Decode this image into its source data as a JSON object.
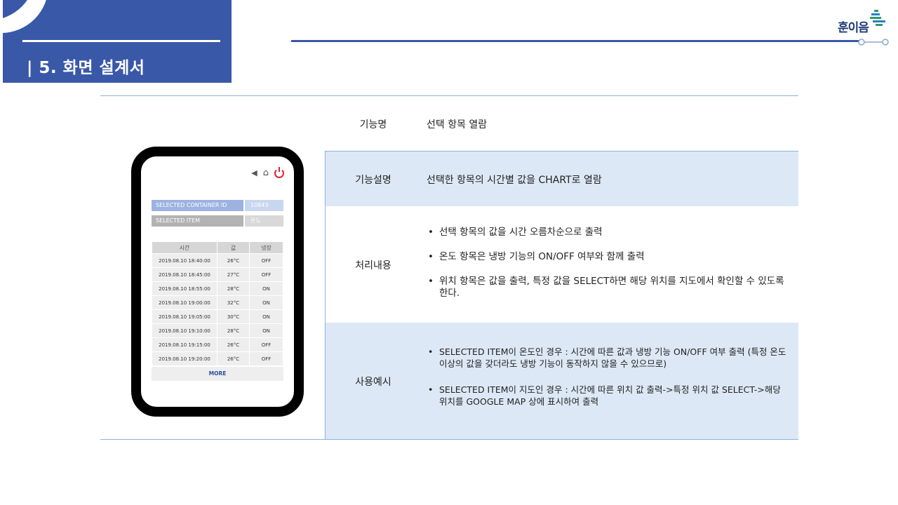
{
  "header": {
    "title": "| 5. 화면 설계서"
  },
  "logo": {
    "text": "훈이음"
  },
  "table": {
    "rows": [
      {
        "label": "기능명",
        "value": "선택 항목 열람"
      },
      {
        "label": "기능설명",
        "value": "선택한 항목의 시간별 값을 CHART로 열람"
      },
      {
        "label": "처리내용",
        "bullets": [
          "선택 항목의 값을 시간 오름차순으로 출력",
          "온도 항목은 냉방 기능의 ON/OFF 여부와 함께 출력",
          "위치 항목은 값을 출력, 특정 값을 SELECT하면 해당 위치를 지도에서 확인할 수 있도록 한다."
        ]
      },
      {
        "label": "사용예시",
        "bullets": [
          "SELECTED ITEM이 온도인 경우 : 시간에 따른 값과 냉방 기능 ON/OFF 여부 출력 (특정 온도 이상의 값을 갖더라도 냉방 기능이 동작하지 않을 수 있으므로)",
          "SELECTED ITEM이 지도인 경우 : 시간에 따른 위치 값 출력->특정 위치 값 SELECT->해당 위치를 GOOGLE MAP 상에 표시하여 출력"
        ]
      }
    ]
  },
  "phone": {
    "icons": [
      "back-icon",
      "home-icon",
      "power-icon"
    ],
    "container_label": "SELECTED CONTAINER ID",
    "container_value": "10843",
    "item_label": "SELECTED ITEM",
    "item_value": "온도",
    "columns": [
      "시간",
      "값",
      "냉장"
    ],
    "rows": [
      [
        "2019.08.10 18:40:00",
        "26°C",
        "OFF"
      ],
      [
        "2019.08.10 18:45:00",
        "27°C",
        "OFF"
      ],
      [
        "2019.08.10 18:55:00",
        "28°C",
        "ON"
      ],
      [
        "2019.08.10 19:00:00",
        "32°C",
        "ON"
      ],
      [
        "2019.08.10 19:05:00",
        "30°C",
        "ON"
      ],
      [
        "2019.08.10 19:10:00",
        "28°C",
        "ON"
      ],
      [
        "2019.08.10 19:15:00",
        "26°C",
        "OFF"
      ],
      [
        "2019.08.10 19:20:00",
        "26°C",
        "OFF"
      ]
    ],
    "more_label": "MORE"
  },
  "colors": {
    "header_blue": "#3a58a8",
    "band": "#dce8f5",
    "rule": "#8fb2d6",
    "power_red": "#dd2233"
  }
}
